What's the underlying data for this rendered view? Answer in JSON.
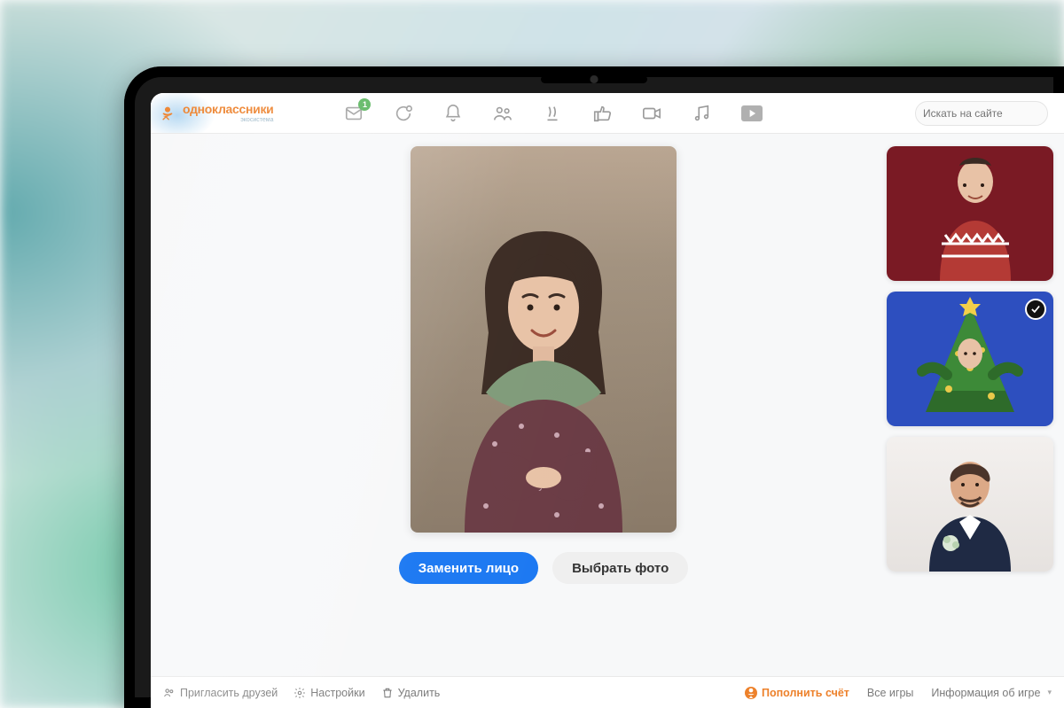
{
  "brand": {
    "name": "одноклассники",
    "subtitle": "экосистема",
    "color": "#ed812b"
  },
  "nav": {
    "messages_badge": "1"
  },
  "search": {
    "placeholder": "Искать на сайте"
  },
  "actions": {
    "primary": "Заменить лицо",
    "secondary": "Выбрать фото"
  },
  "thumbs": {
    "t1": {
      "bg": "#7a1a24",
      "selected": false,
      "desc": "man-sweater"
    },
    "t2": {
      "bg": "#2d4fbf",
      "selected": true,
      "desc": "tree-costume"
    },
    "t3": {
      "bg": "#efeceb",
      "selected": false,
      "desc": "man-suit"
    }
  },
  "footer": {
    "invite": "Пригласить друзей",
    "settings": "Настройки",
    "delete": "Удалить",
    "topup": "Пополнить счёт",
    "all_games": "Все игры",
    "game_info": "Информация об игре"
  }
}
